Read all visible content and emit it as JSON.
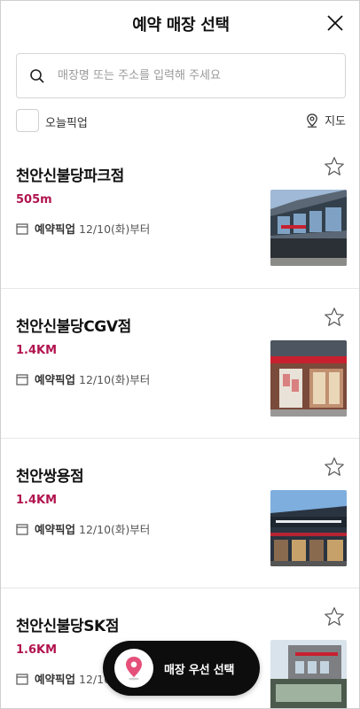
{
  "header": {
    "title": "예약 매장 선택",
    "close_icon": "close-icon"
  },
  "search": {
    "placeholder": "매장명 또는 주소를 입력해 주세요",
    "value": "",
    "icon": "search-icon"
  },
  "filter": {
    "today_pickup_label": "오늘픽업",
    "today_pickup_checked": false,
    "map_label": "지도",
    "map_icon": "map-pin-icon"
  },
  "colors": {
    "distance": "#b1134e",
    "cta_background": "#0d0d0d",
    "pin": "#e4507a"
  },
  "stores": [
    {
      "name": "천안신불당파크점",
      "distance": "505m",
      "pickup_label": "예약픽업",
      "pickup_date": "12/10(화)부터",
      "favorite": false
    },
    {
      "name": "천안신불당CGV점",
      "distance": "1.4KM",
      "pickup_label": "예약픽업",
      "pickup_date": "12/10(화)부터",
      "favorite": false
    },
    {
      "name": "천안쌍용점",
      "distance": "1.4KM",
      "pickup_label": "예약픽업",
      "pickup_date": "12/10(화)부터",
      "favorite": false
    },
    {
      "name": "천안신불당SK점",
      "distance": "1.6KM",
      "pickup_label": "예약픽업",
      "pickup_date": "12/10(화)부터",
      "favorite": false
    }
  ],
  "cta": {
    "label": "매장 우선 선택",
    "icon": "location-pin-icon"
  }
}
